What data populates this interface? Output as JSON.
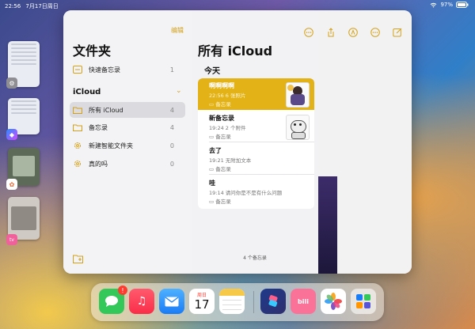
{
  "status_bar": {
    "time": "22:56",
    "date": "7月17日周日",
    "battery": "97%"
  },
  "sidebar": {
    "edit_label": "编辑",
    "title": "文件夹",
    "quick_note": {
      "label": "快速备忘录",
      "count": "1"
    },
    "section": "iCloud",
    "folders": [
      {
        "label": "所有 iCloud",
        "count": "4"
      },
      {
        "label": "备忘录",
        "count": "4"
      },
      {
        "label": "新建智能文件夹",
        "count": "0"
      },
      {
        "label": "真的吗",
        "count": "0"
      }
    ]
  },
  "list": {
    "title": "所有 iCloud",
    "day_header": "今天",
    "notes": [
      {
        "title": "啊啊啊啊",
        "meta": "22:56  6 张照片",
        "folder": "备忘录"
      },
      {
        "title": "新备忘录",
        "meta": "19:24  2 个附件",
        "folder": "备忘录"
      },
      {
        "title": "去了",
        "meta": "19:21  无附加文本",
        "folder": "备忘录"
      },
      {
        "title": "哇",
        "meta": "19:14  请问你是不是有什么问题",
        "folder": "备忘录"
      }
    ],
    "footer_count": "4 个备忘录"
  },
  "dock": {
    "messages_badge": "!",
    "calendar_weekday": "周日",
    "calendar_day": "17"
  },
  "colors": {
    "accent": "#e2b216",
    "selected_row": "#dadadf"
  }
}
